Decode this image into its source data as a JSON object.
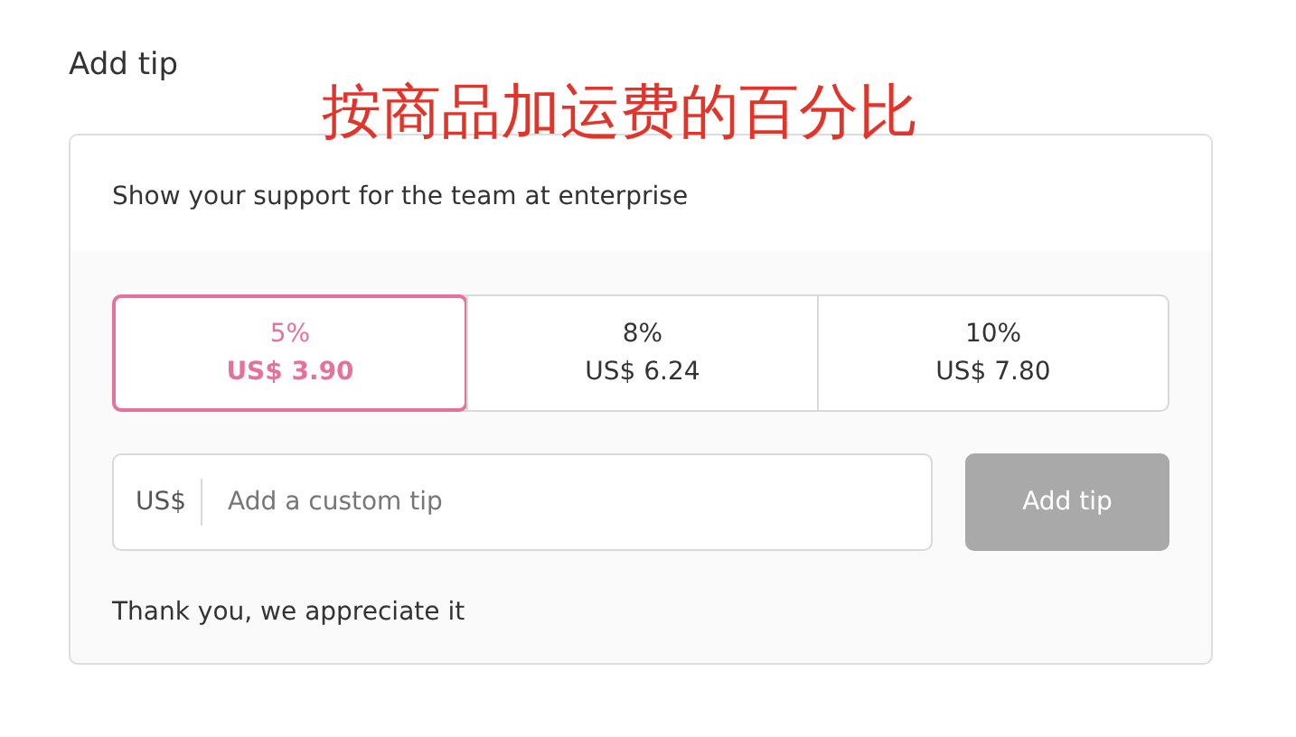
{
  "heading": "Add tip",
  "annotation": "按商品加运费的百分比",
  "message": "Show your support for the team at enterprise",
  "options": [
    {
      "percent": "5%",
      "amount": "US$ 3.90",
      "selected": true
    },
    {
      "percent": "8%",
      "amount": "US$ 6.24",
      "selected": false
    },
    {
      "percent": "10%",
      "amount": "US$ 7.80",
      "selected": false
    }
  ],
  "custom_tip": {
    "prefix": "US$",
    "placeholder": "Add a custom tip"
  },
  "button": {
    "label": "Add tip",
    "disabled": true
  },
  "thanks": "Thank you, we appreciate it"
}
